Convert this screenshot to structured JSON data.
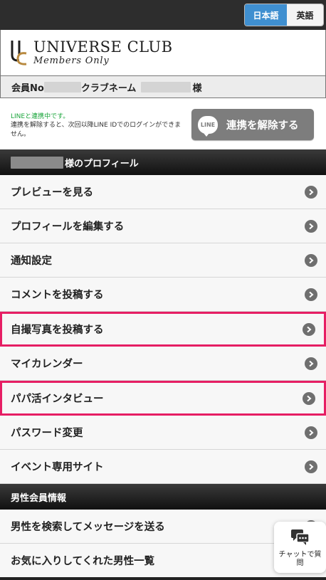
{
  "language": {
    "japanese_label": "日本語",
    "english_label": "英語"
  },
  "brand": {
    "title": "UNIVERSE CLUB",
    "subtitle": "Members Only"
  },
  "member": {
    "no_label": "会員No",
    "club_name_label": "クラブネーム",
    "honorific": "様"
  },
  "line": {
    "status": "LINEと連携中です。",
    "description": "連携を解除すると、次回以降LINE IDでのログインができません。",
    "button_label": "連携を解除する",
    "logo_text": "LINE"
  },
  "profile_section": {
    "title": "様のプロフィール"
  },
  "menu": [
    {
      "label": "プレビューを見る"
    },
    {
      "label": "プロフィールを編集する"
    },
    {
      "label": "通知設定"
    },
    {
      "label": "コメントを投稿する"
    },
    {
      "label": "自撮写真を投稿する"
    },
    {
      "label": "マイカレンダー"
    },
    {
      "label": "パパ活インタビュー"
    },
    {
      "label": "パスワード変更"
    },
    {
      "label": "イベント専用サイト"
    }
  ],
  "male_section": {
    "title": "男性会員情報",
    "items": [
      {
        "label": "男性を検索してメッセージを送る"
      },
      {
        "label": "お気に入りしてくれた男性一覧"
      }
    ]
  },
  "chat": {
    "label": "チャットで質問",
    "icon": "chat-bubbles-icon"
  },
  "colors": {
    "accent": "#3f8fd0",
    "highlight": "#e61e64",
    "line_green": "#1aa53b",
    "button_gray": "#7d7d7d"
  }
}
